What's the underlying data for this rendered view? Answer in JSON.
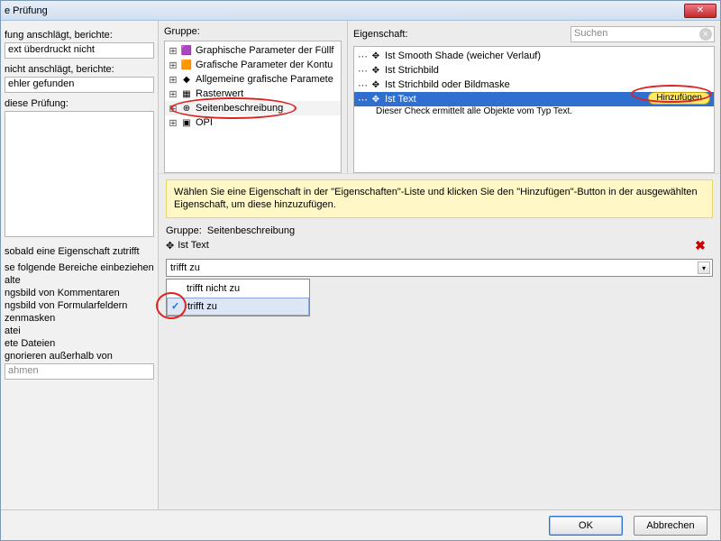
{
  "window": {
    "title": "e Prüfung"
  },
  "left": {
    "l1": "fung anschlägt, berichte:",
    "t1": "ext überdruckt nicht",
    "l2": "nicht anschlägt, berichte:",
    "t2": "ehler gefunden",
    "l3": "diese Prüfung:",
    "l4": "sobald eine Eigenschaft zutrifft",
    "l5": "se folgende Bereiche einbeziehen:",
    "items": [
      "alte",
      "ngsbild von Kommentaren",
      "ngsbild von Formularfeldern",
      "zenmasken",
      "atei",
      "ete Dateien",
      "gnorieren außerhalb von"
    ],
    "t3": "ahmen"
  },
  "gruppe": {
    "title": "Gruppe:",
    "items": [
      {
        "label": "Graphische Parameter der Füllf"
      },
      {
        "label": "Grafische Parameter der Kontu"
      },
      {
        "label": "Allgemeine grafische Paramete"
      },
      {
        "label": "Rasterwert"
      },
      {
        "label": "Seitenbeschreibung",
        "selected": true
      },
      {
        "label": "OPI"
      }
    ]
  },
  "eigenschaft": {
    "title": "Eigenschaft:",
    "search_placeholder": "Suchen",
    "items": [
      {
        "label": "Ist Smooth Shade (weicher Verlauf)"
      },
      {
        "label": "Ist Strichbild"
      },
      {
        "label": "Ist Strichbild oder Bildmaske"
      },
      {
        "label": "Ist Text",
        "selected": true,
        "add": "Hinzufügen",
        "desc": "Dieser Check ermittelt alle Objekte vom Typ Text."
      }
    ]
  },
  "hint": "Wählen Sie eine Eigenschaft in der \"Eigenschaften\"-Liste und klicken Sie den \"Hinzufügen\"-Button in der ausgewählten Eigenschaft, um diese hinzuzufügen.",
  "selgroup_label": "Gruppe:",
  "selgroup_value": "Seitenbeschreibung",
  "selprop": "Ist Text",
  "combo": {
    "value": "trifft zu",
    "options": [
      "trifft nicht zu",
      "trifft zu"
    ],
    "selected": 1
  },
  "footer": {
    "ok": "OK",
    "cancel": "Abbrechen"
  }
}
